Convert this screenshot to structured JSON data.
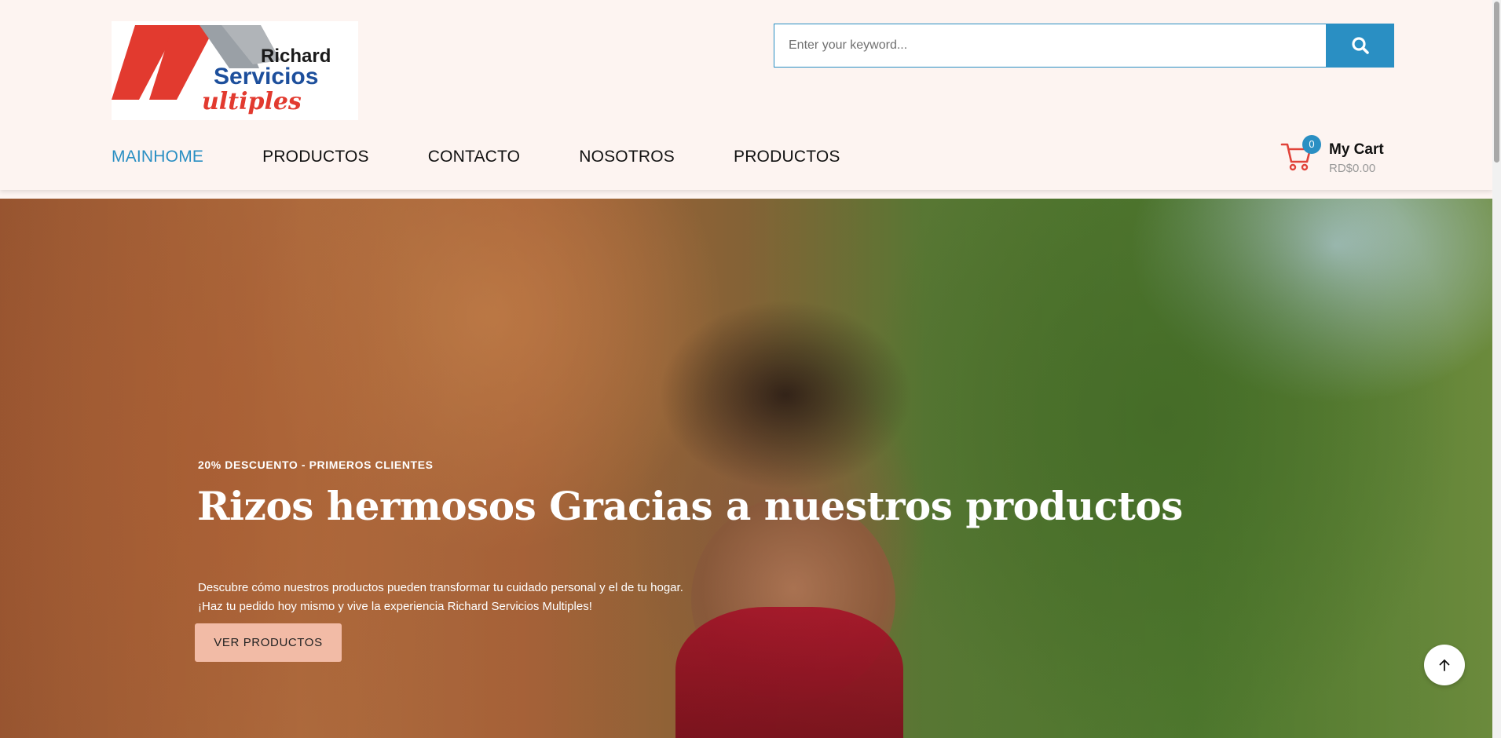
{
  "logo": {
    "text_line1": "Richard",
    "text_line2": "Servicios",
    "text_line3": "ultiples",
    "colors": {
      "red": "#e23a2f",
      "gray": "#9aa0a6",
      "blue": "#1d4f9c"
    }
  },
  "search": {
    "placeholder": "Enter your keyword...",
    "value": "",
    "icon": "search-icon"
  },
  "nav": {
    "items": [
      {
        "label": "MAINHOME",
        "active": true
      },
      {
        "label": "PRODUCTOS",
        "active": false
      },
      {
        "label": "CONTACTO",
        "active": false
      },
      {
        "label": "NOSOTROS",
        "active": false
      },
      {
        "label": "PRODUCTOS",
        "active": false
      }
    ]
  },
  "cart": {
    "count": "0",
    "title": "My Cart",
    "amount": "RD$0.00",
    "icon": "cart-icon"
  },
  "hero": {
    "tag": "20% DESCUENTO - PRIMEROS CLIENTES",
    "title": "Rizos hermosos Gracias a nuestros productos",
    "desc_line1": "Descubre cómo nuestros productos pueden transformar tu cuidado personal y el de tu hogar.",
    "desc_line2": "¡Haz tu pedido hoy mismo y vive la experiencia Richard Servicios Multiples!",
    "button_label": "VER PRODUCTOS"
  },
  "scroll_top": {
    "icon": "arrow-up-icon"
  },
  "colors": {
    "accent": "#2a8fc3",
    "header_bg": "#fdf4f1",
    "button_bg": "#f2bba6",
    "cart_red": "#e0433a"
  }
}
